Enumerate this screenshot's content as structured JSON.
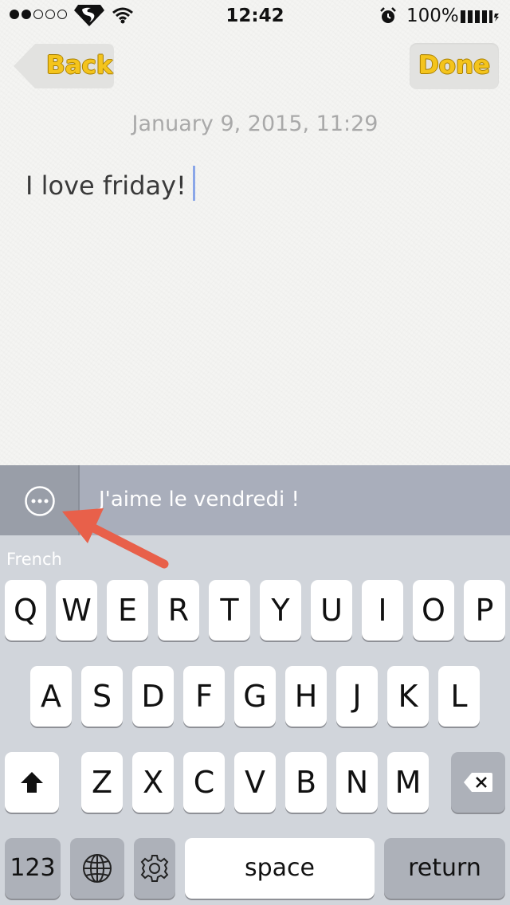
{
  "status_bar": {
    "signal_bars_filled": 2,
    "signal_bars_total": 5,
    "carrier_icon": "superman-logo-icon",
    "wifi_icon": "wifi-icon",
    "time": "12:42",
    "alarm_icon": "alarm-clock-icon",
    "battery_percent": "100%",
    "battery_icon": "battery-icon"
  },
  "nav": {
    "back_label": "Back",
    "done_label": "Done",
    "accent_color": "#f4c41c"
  },
  "note": {
    "date": "January 9, 2015, 11:29",
    "body": "I love friday!"
  },
  "translation_bar": {
    "options_icon": "ellipsis-circle-icon",
    "translation": "J'aime le vendredi !"
  },
  "keyboard": {
    "language": "French",
    "row1": [
      "Q",
      "W",
      "E",
      "R",
      "T",
      "Y",
      "U",
      "I",
      "O",
      "P"
    ],
    "row2": [
      "A",
      "S",
      "D",
      "F",
      "G",
      "H",
      "J",
      "K",
      "L"
    ],
    "row3": [
      "Z",
      "X",
      "C",
      "V",
      "B",
      "N",
      "M"
    ],
    "numbers_label": "123",
    "space_label": "space",
    "return_label": "return"
  },
  "annotation": {
    "arrow_color": "#e8604a",
    "arrow_icon": "red-arrow-icon"
  }
}
